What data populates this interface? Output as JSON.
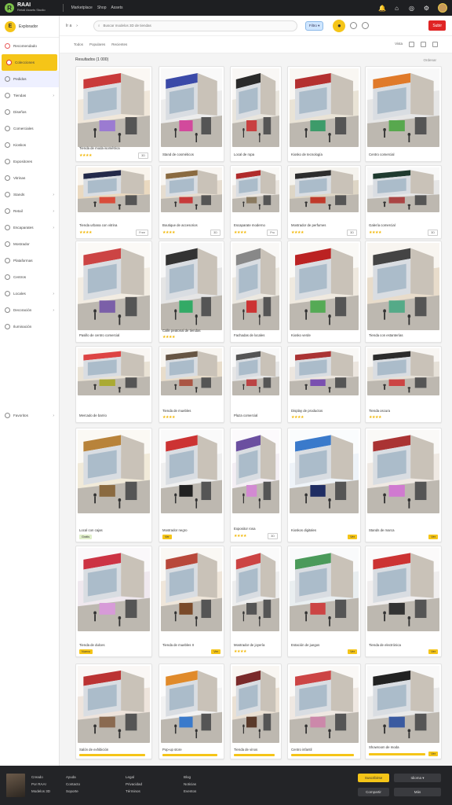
{
  "topbar": {
    "brand": "RAAI",
    "brand_sub": "Retail Assets Studio",
    "links": [
      "Marketplace",
      "Shop",
      "Assets"
    ]
  },
  "sidebar": {
    "header_label": "Explorador",
    "items": [
      {
        "label": "Recomendado",
        "accent": true
      },
      {
        "label": "Colecciones",
        "active": true
      },
      {
        "label": "Pedidos",
        "soft": true
      },
      {
        "label": "Tiendas",
        "caret": "›"
      },
      {
        "label": "Diseños"
      },
      {
        "label": "Comerciales"
      },
      {
        "label": "Kioskos"
      },
      {
        "label": "Expositores"
      },
      {
        "label": "Vitrinas"
      },
      {
        "label": "Stands",
        "caret": "›"
      },
      {
        "label": "Retail",
        "caret": "›"
      },
      {
        "label": "Escaparates",
        "caret": "›"
      },
      {
        "label": "Mostrador"
      },
      {
        "label": "Plataformas"
      },
      {
        "label": "Centros"
      },
      {
        "label": "Locales",
        "caret": "›"
      },
      {
        "label": "Decoración",
        "caret": "›"
      },
      {
        "label": "Iluminación"
      },
      {
        "label": "Favoritos",
        "caret": "›"
      }
    ]
  },
  "toolbar": {
    "nav": [
      "Ir a",
      "›"
    ],
    "search_placeholder": "Buscar modelos 3D de tiendas",
    "chip": "Filtro ▾",
    "red_button": "Subir"
  },
  "subbar": {
    "left": [
      "Todos",
      "Populares",
      "Recientes"
    ],
    "right": [
      "Vista"
    ]
  },
  "section": {
    "title": "Resultados (1 000)",
    "right": "Ordenar"
  },
  "cards": [
    {
      "title": "Tienda de moda isométrica",
      "stars": "★★★★",
      "tag": "3D",
      "kind": "title"
    },
    {
      "title": "Stand de cosméticos",
      "stars": "",
      "tag": "",
      "kind": "title"
    },
    {
      "title": "Local de ropa",
      "stars": "",
      "tag": "",
      "kind": "title"
    },
    {
      "title": "Kiosko de tecnología",
      "stars": "",
      "tag": "",
      "kind": "title"
    },
    {
      "title": "Centro comercial",
      "stars": "",
      "tag": "",
      "kind": "title"
    },
    {
      "title": "Tienda urbana con vitrina",
      "stars": "★★★★",
      "tag": "Free",
      "kind": "stars"
    },
    {
      "title": "Boutique de accesorios",
      "stars": "★★★★",
      "tag": "3D",
      "kind": "stars"
    },
    {
      "title": "Escaparate moderno",
      "stars": "★★★★",
      "tag": "Pro",
      "kind": "stars"
    },
    {
      "title": "Mostrador de perfumes",
      "stars": "★★★★",
      "tag": "3D",
      "kind": "stars"
    },
    {
      "title": "Galería comercial",
      "stars": "★★★★",
      "tag": "3D",
      "kind": "stars"
    },
    {
      "title": "Pasillo de centro comercial",
      "stars": "",
      "tag": "",
      "kind": "title"
    },
    {
      "title": "Calle peatonal de tiendas",
      "stars": "★★★★",
      "tag": "",
      "kind": "stars"
    },
    {
      "title": "Fachadas de locales",
      "stars": "",
      "tag": "",
      "kind": "title"
    },
    {
      "title": "Kiosko verde",
      "stars": "",
      "tag": "",
      "kind": "title"
    },
    {
      "title": "Tienda con estanterías",
      "stars": "",
      "tag": "",
      "kind": "title"
    },
    {
      "title": "Mercado de barrio",
      "stars": "",
      "tag": "",
      "kind": "title"
    },
    {
      "title": "Tienda de muebles",
      "stars": "★★★★",
      "tag": "",
      "kind": "stars"
    },
    {
      "title": "Plaza comercial",
      "stars": "",
      "tag": "",
      "kind": "title"
    },
    {
      "title": "Display de productos",
      "stars": "★★★★",
      "tag": "",
      "kind": "stars"
    },
    {
      "title": "Tienda oscura",
      "stars": "★★★★",
      "tag": "",
      "kind": "stars"
    },
    {
      "title": "Local con cajas",
      "stars": "",
      "tag": "Gratis",
      "kind": "badge-green"
    },
    {
      "title": "Mostrador negro",
      "stars": "",
      "tag": "Ver",
      "kind": "badge"
    },
    {
      "title": "Expositor rosa",
      "stars": "★★★★",
      "tag": "3D",
      "kind": "stars"
    },
    {
      "title": "Kioskos digitales",
      "stars": "",
      "tag": "Ver",
      "kind": "badge-right"
    },
    {
      "title": "Stands de marca",
      "stars": "",
      "tag": "Ver",
      "kind": "badge-right"
    },
    {
      "title": "Tienda de dulces",
      "stars": "",
      "tag": "Nuevo",
      "kind": "badge"
    },
    {
      "title": "Tienda de muebles II",
      "stars": "",
      "tag": "Ver",
      "kind": "badge-right"
    },
    {
      "title": "Mostrador de joyería",
      "stars": "★★★★",
      "tag": "",
      "kind": "stars"
    },
    {
      "title": "Estación de juegos",
      "stars": "",
      "tag": "Ver",
      "kind": "badge-right"
    },
    {
      "title": "Tienda de electrónica",
      "stars": "",
      "tag": "Ver",
      "kind": "badge-right"
    },
    {
      "title": "Salón de exhibición",
      "stars": "",
      "tag": "",
      "kind": "bar"
    },
    {
      "title": "Pop-up store",
      "stars": "",
      "tag": "",
      "kind": "bar"
    },
    {
      "title": "Tienda de vinos",
      "stars": "",
      "tag": "",
      "kind": "bar"
    },
    {
      "title": "Centro infantil",
      "stars": "",
      "tag": "",
      "kind": "bar"
    },
    {
      "title": "Showroom de moda",
      "stars": "",
      "tag": "Ver",
      "kind": "bar"
    }
  ],
  "footer": {
    "col1": [
      "Creado",
      "Por RAAI",
      "Modelos 3D"
    ],
    "col2": [
      "Ayuda",
      "Contacto",
      "Soporte"
    ],
    "col3": [
      "Legal",
      "Privacidad",
      "Términos"
    ],
    "col4": [
      "Blog",
      "Noticias",
      "Eventos"
    ],
    "btn_primary": "Suscribirse",
    "btn_secondary": "Idioma ▾",
    "btn_third": "Compartir",
    "btn_fourth": "Más"
  },
  "colors": {
    "accent_yellow": "#f5c518",
    "accent_red": "#e02424",
    "dark": "#1e1f22"
  }
}
